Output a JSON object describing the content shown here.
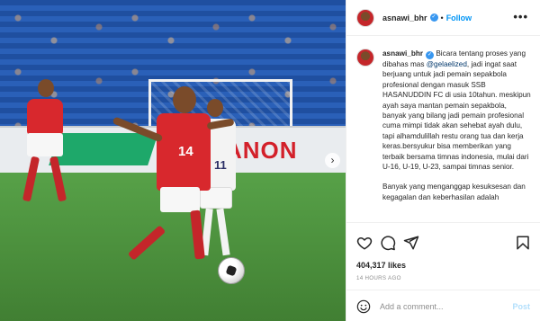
{
  "post": {
    "username": "asnawi_bhr",
    "follow_label": "Follow",
    "dot": "•",
    "more": "•••",
    "caption_p1_before": " Bicara tentang proses yang dibahas mas ",
    "mention": "@gelaelized",
    "caption_p1_after": ", jadi ingat saat berjuang untuk jadi pemain sepakbola profesional dengan masuk SSB HASANUDDIN FC di usia 10tahun. meskipun ayah saya mantan pemain sepakbola, banyak yang bilang jadi pemain profesional cuma mimpi tidak akan sehebat ayah dulu, tapi alhamdulillah restu orang tua dan kerja keras.bersyukur bisa memberikan yang terbaik bersama timnas indonesia, mulai dari U-16, U-19, U-23, sampai timnas senior.",
    "caption_p2": "Banyak yang menganggap kesuksesan dan kegagalan dan keberhasilan adalah",
    "likes": "404,317 likes",
    "time": "14 HOURS AGO",
    "comment_placeholder": "Add a comment...",
    "post_label": "Post"
  },
  "photo": {
    "board_text": "ANON",
    "player_front_number": "14",
    "player_back_number": "11",
    "carousel_next": "›"
  },
  "icons": [
    "avatar",
    "verified-icon",
    "more-icon",
    "heart-icon",
    "comment-icon",
    "share-icon",
    "bookmark-icon",
    "emoji-icon",
    "chevron-right-icon"
  ],
  "colors": {
    "accent": "#0095f6",
    "verified": "#3897f0",
    "jersey_red": "#d8282d",
    "pitch_green": "#4a8d3b"
  }
}
